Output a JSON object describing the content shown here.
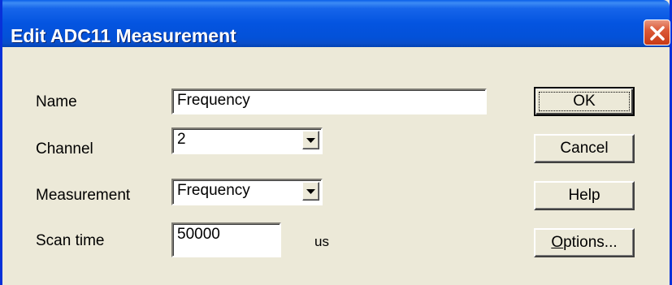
{
  "window": {
    "title": "Edit ADC11 Measurement"
  },
  "form": {
    "name": {
      "label": "Name",
      "value": "Frequency"
    },
    "channel": {
      "label": "Channel",
      "value": "2"
    },
    "measurement": {
      "label": "Measurement",
      "value": "Frequency"
    },
    "scan_time": {
      "label": "Scan time",
      "value": "50000",
      "unit": "us"
    }
  },
  "buttons": {
    "ok": "OK",
    "cancel": "Cancel",
    "help": "Help",
    "options_first": "O",
    "options_rest": "ptions..."
  },
  "colors": {
    "titlebar": "#0454e0",
    "dialog_bg": "#ece9d8",
    "close_button": "#dc5a38"
  },
  "icons": {
    "close": "close-icon",
    "dropdown": "chevron-down-icon"
  }
}
